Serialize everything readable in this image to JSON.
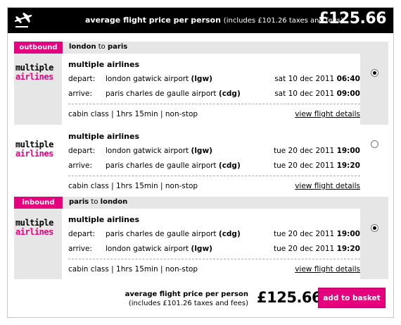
{
  "header": {
    "plane_icon": "plane-icon",
    "title": "average flight price per person",
    "subtitle": "(includes £101.26 taxes and fees)",
    "price": "£125.66"
  },
  "outbound": {
    "badge": "outbound",
    "from": "london",
    "to_word": "to",
    "to": "paris"
  },
  "inbound": {
    "badge": "inbound",
    "from": "paris",
    "to_word": "to",
    "to": "london"
  },
  "logo": {
    "line1": "multiple",
    "line2": "airlines"
  },
  "labels": {
    "depart": "depart:",
    "arrive": "arrive:",
    "view_details": "view flight details"
  },
  "options": [
    {
      "selected": true,
      "airline": "multiple airlines",
      "depart_airport": "london gatwick airport ",
      "depart_code": "(lgw)",
      "depart_date": "sat 10 dec 2011 ",
      "depart_time": "06:40",
      "arrive_airport": "paris charles de gaulle airport ",
      "arrive_code": "(cdg)",
      "arrive_date": "sat 10 dec 2011 ",
      "arrive_time": "09:00",
      "meta": "cabin class  |  1hrs 15min  |  non-stop"
    },
    {
      "selected": false,
      "airline": "multiple airlines",
      "depart_airport": "london gatwick airport ",
      "depart_code": "(lgw)",
      "depart_date": "tue 20 dec 2011 ",
      "depart_time": "19:00",
      "arrive_airport": "paris charles de gaulle airport ",
      "arrive_code": "(cdg)",
      "arrive_date": "tue 20 dec 2011 ",
      "arrive_time": "19:20",
      "meta": "cabin class  |  1hrs 15min  |  non-stop"
    },
    {
      "selected": true,
      "airline": "multiple airlines",
      "depart_airport": "paris charles de gaulle airport ",
      "depart_code": "(cdg)",
      "depart_date": "tue 20 dec 2011 ",
      "depart_time": "19:00",
      "arrive_airport": "london gatwick airport ",
      "arrive_code": "(lgw)",
      "arrive_date": "tue 20 dec 2011 ",
      "arrive_time": "19:20",
      "meta": "cabin class  |  1hrs 15min  |  non-stop"
    }
  ],
  "footer": {
    "title": "average flight price per person",
    "subtitle": "(includes £101.26 taxes and fees)",
    "price": "£125.66",
    "button": "add to basket"
  },
  "colors": {
    "accent": "#e5007d",
    "header_bg": "#000000",
    "selected_bg": "#e6e6e6"
  }
}
